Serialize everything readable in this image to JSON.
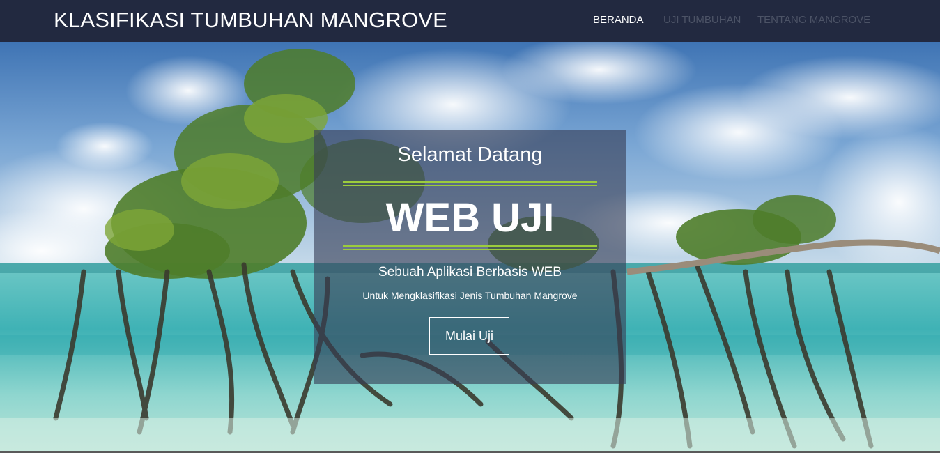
{
  "navbar": {
    "brand": "KLASIFIKASI TUMBUHAN MANGROVE",
    "links": [
      {
        "label": "BERANDA",
        "state": "active"
      },
      {
        "label": "UJI TUMBUHAN",
        "state": "inactive"
      },
      {
        "label": "TENTANG MANGROVE",
        "state": "inactive"
      }
    ]
  },
  "hero": {
    "welcome": "Selamat Datang",
    "title": "WEB UJI",
    "subtitle": "Sebuah Aplikasi Berbasis WEB",
    "description": "Untuk Mengklasifikasi Jenis Tumbuhan Mangrove",
    "cta_label": "Mulai Uji"
  },
  "colors": {
    "navbar_bg": "#222940",
    "accent_rule": "#9ccc3c",
    "nav_active": "#ffffff",
    "nav_inactive": "#4c5366"
  }
}
